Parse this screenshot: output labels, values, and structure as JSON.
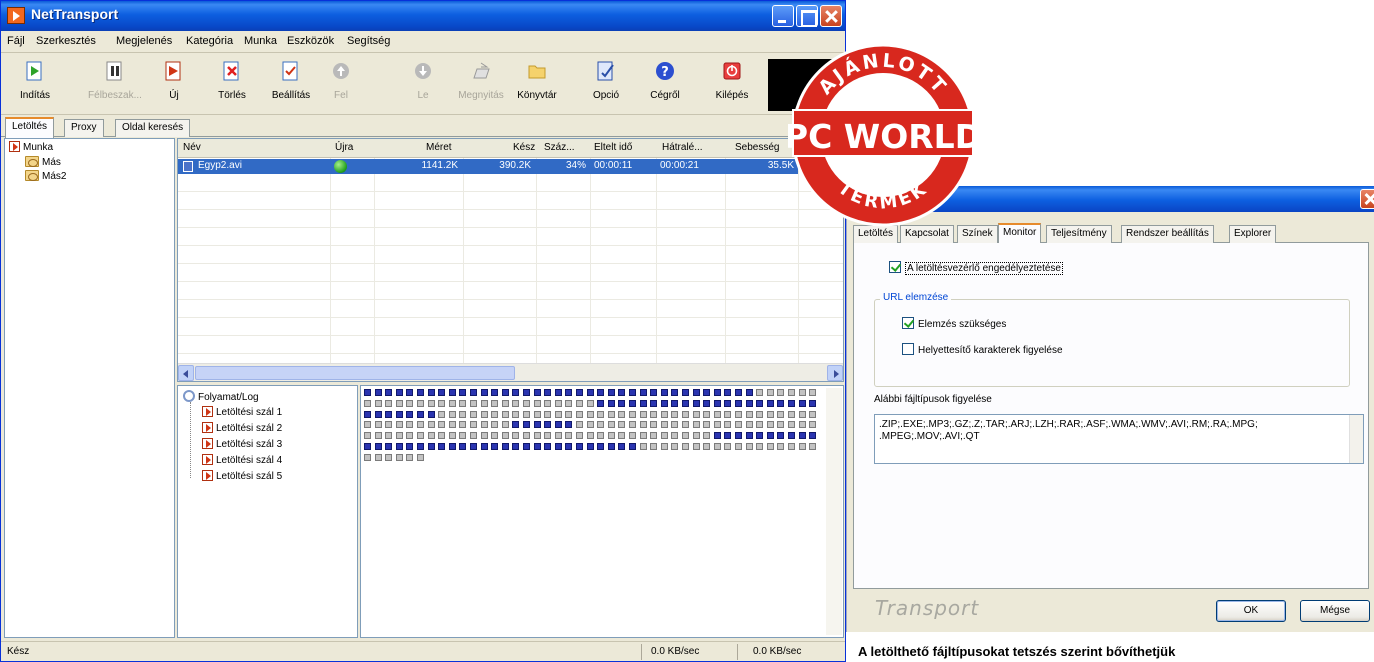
{
  "main_window": {
    "title": "NetTransport",
    "menu": [
      "Fájl",
      "Szerkesztés",
      "Megjelenés",
      "Kategória",
      "Munka",
      "Eszközök",
      "Segítség"
    ],
    "toolbar": [
      {
        "label": "Indítás",
        "icon": "play-icon",
        "enabled": true
      },
      {
        "label": "Félbeszak...",
        "icon": "pause-icon",
        "enabled": false
      },
      {
        "label": "Új",
        "icon": "new-arrow-icon",
        "enabled": true
      },
      {
        "label": "Törlés",
        "icon": "delete-icon",
        "enabled": true
      },
      {
        "label": "Beállítás",
        "icon": "properties-icon",
        "enabled": true
      },
      {
        "label": "Fel",
        "icon": "up-arrow-icon",
        "enabled": false
      },
      {
        "label": "Le",
        "icon": "down-arrow-icon",
        "enabled": false
      },
      {
        "label": "Megnyitás",
        "icon": "open-icon",
        "enabled": false
      },
      {
        "label": "Könyvtár",
        "icon": "folder-icon",
        "enabled": true
      },
      {
        "label": "Opció",
        "icon": "options-icon",
        "enabled": true
      },
      {
        "label": "Cégről",
        "icon": "help-icon",
        "enabled": true
      },
      {
        "label": "Kilépés",
        "icon": "power-icon",
        "enabled": true
      }
    ],
    "tabs": [
      "Letöltés",
      "Proxy",
      "Oldal keresés"
    ],
    "tree": {
      "root": "Munka",
      "children": [
        "Más",
        "Más2"
      ]
    },
    "list": {
      "columns": [
        "Név",
        "Újra",
        "Méret",
        "Kész",
        "Száz...",
        "Eltelt idő",
        "Hátralé...",
        "Sebesség"
      ],
      "rows": [
        {
          "name": "Egyp2.avi",
          "size": "1141.2K",
          "done": "390.2K",
          "percent": "34%",
          "elapsed": "00:00:11",
          "remaining": "00:00:21",
          "speed": "35.5K"
        }
      ]
    },
    "log": {
      "root": "Folyamat/Log",
      "threads": [
        "Letöltési szál 1",
        "Letöltési szál 2",
        "Letöltési szál 3",
        "Letöltési szál 4",
        "Letöltési szál 5"
      ]
    },
    "blocks": {
      "columns": 43,
      "rows": [
        "bbbbbbbbbbbbbbbbbbbbbbbbbbbbbbbbbbbbbgggggg",
        "ggggggggggggggggggggggbbbbbbbbbbbbbbbbbbbbb",
        "bbbbbbbgggggggggggggggggggggggggggggggggggggg",
        "ggggggggggggggbbbbbbgggggggggggggggggggggggggg",
        "gggggggggggggggggggggggggggggggggbbbbbbbbbbbb",
        "bbbbbbbbbbbbbbbbbbbbbbbbbbgggggggggggggggggg",
        "gggggg"
      ]
    },
    "status": {
      "left": "Kész",
      "speed1": "0.0 KB/sec",
      "speed2": "0.0 KB/sec"
    }
  },
  "badge": {
    "top": "AJÁNLOTT",
    "middle": "PC WORLD",
    "bottom": "TERMÉK"
  },
  "options_dialog": {
    "tabs": [
      "Letöltés",
      "Kapcsolat",
      "Színek",
      "Monitor",
      "Teljesítmény",
      "Rendszer beállítás",
      "Explorer"
    ],
    "active_tab": "Monitor",
    "enable_monitor": {
      "label": "A letöltésvezérlő engedélyeztetése",
      "checked": true
    },
    "group_title": "URL elemzése",
    "analyze_needed": {
      "label": "Elemzés szükséges",
      "checked": true
    },
    "wildcards": {
      "label": "Helyettesítő karakterek figyelése",
      "checked": false
    },
    "filetypes_label": "Alábbi fájltípusok figyelése",
    "filetypes_line1": ".ZIP;.EXE;.MP3;.GZ;.Z;.TAR;.ARJ;.LZH;.RAR;.ASF;.WMA;.WMV;.AVI;.RM;.RA;.MPG;",
    "filetypes_line2": ".MPEG;.MOV;.AVI;.QT",
    "brand": "Transport",
    "ok_label": "OK",
    "cancel_label": "Mégse"
  },
  "caption": "A letölthető fájltípusokat tetszés szerint bővíthetjük"
}
